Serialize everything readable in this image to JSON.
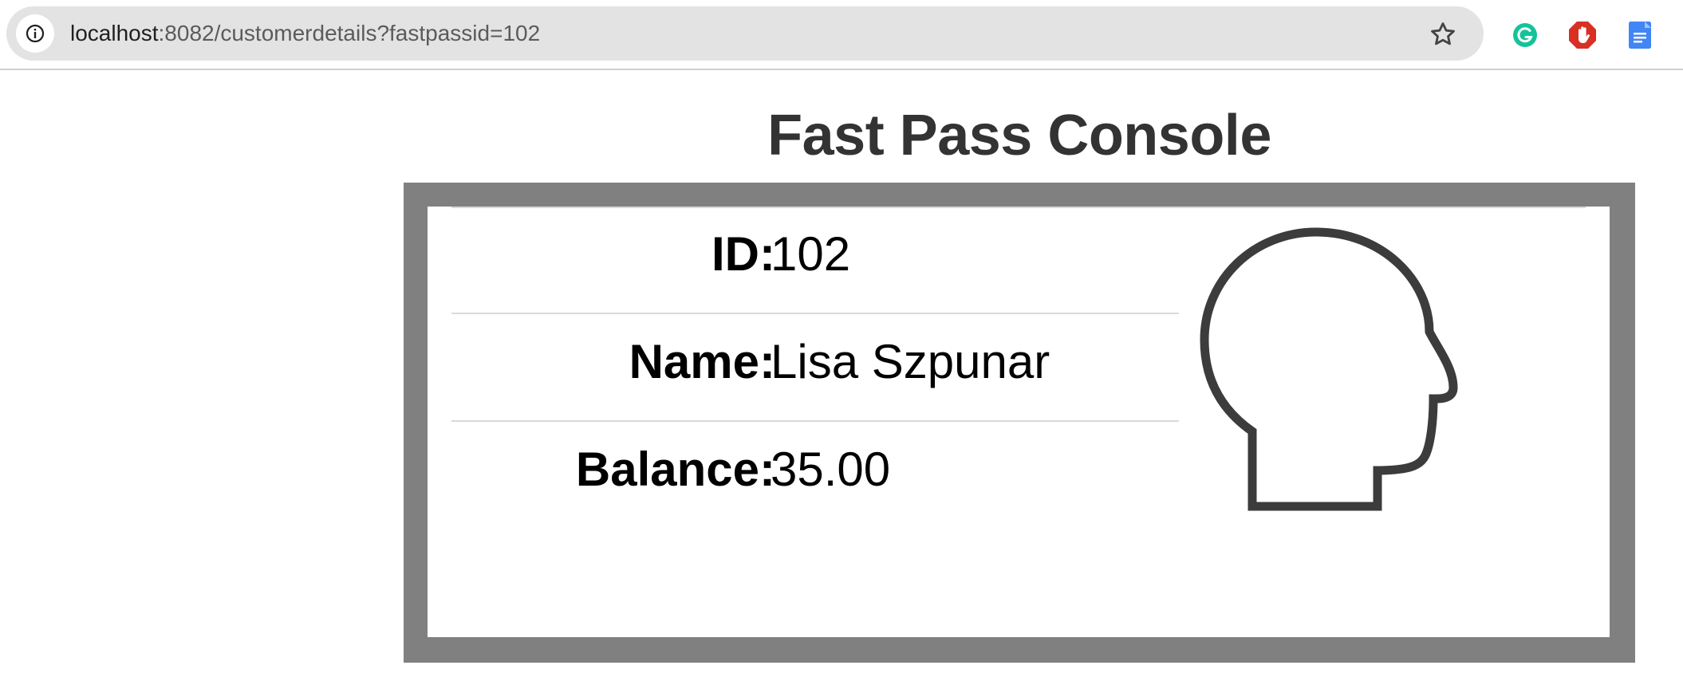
{
  "browser": {
    "url_host": "localhost",
    "url_rest": ":8082/customerdetails?fastpassid=102",
    "icons": [
      "info-icon",
      "bookmark-star-icon",
      "grammarly-extension-icon",
      "adblock-extension-icon",
      "google-docs-extension-icon"
    ]
  },
  "page": {
    "title": "Fast Pass Console"
  },
  "customer": {
    "fields": [
      {
        "label": "ID:",
        "value": "102"
      },
      {
        "label": "Name:",
        "value": "Lisa Szpunar"
      },
      {
        "label": "Balance:",
        "value": "35.00"
      }
    ],
    "avatar_icon": "head-profile-icon"
  },
  "colors": {
    "frame": "#808080",
    "title": "#333333",
    "grammarly": "#15c39a",
    "adblock": "#d93025",
    "docs": "#4285f4"
  }
}
